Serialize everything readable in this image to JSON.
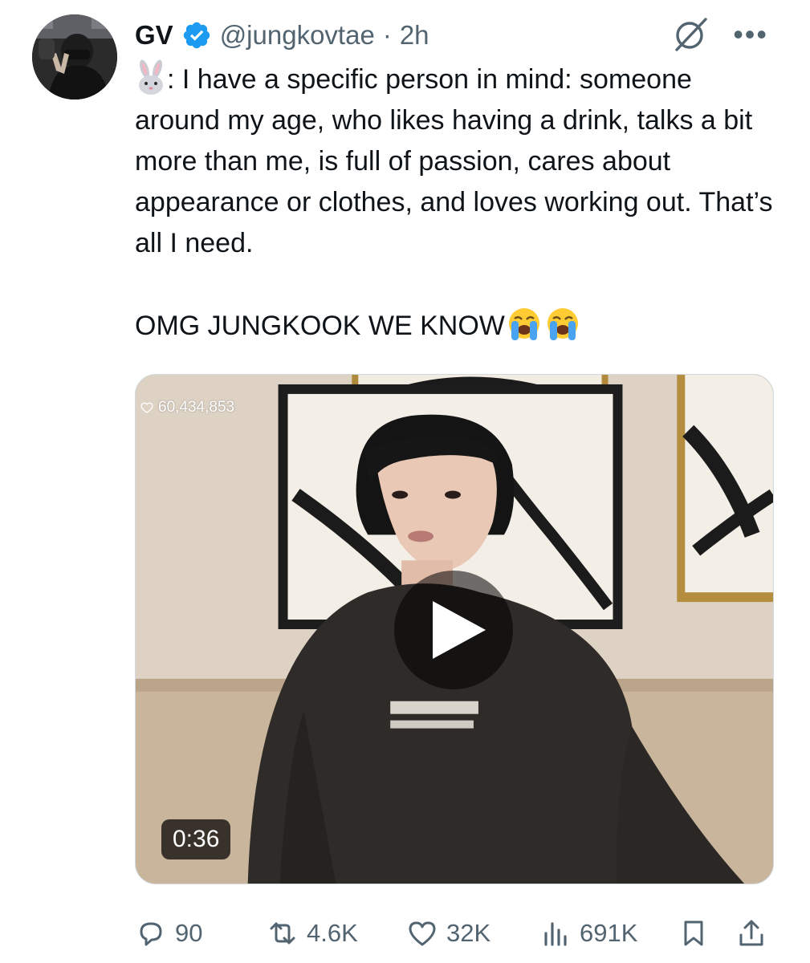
{
  "tweet": {
    "author_name": "GV",
    "handle": "@jungkovtae",
    "separator": "·",
    "time": "2h",
    "icons": {
      "verified": "verified-badge-icon",
      "grok": "grok-icon",
      "more": "more-options-icon"
    },
    "more_glyph": "•••",
    "text": {
      "line1_after_emoji": ": I have a specific person in mind: someone around my age, who likes having a drink, talks a bit more than me, is full of passion, cares about appearance or clothes, and loves working out. That’s all I need.",
      "line2": "OMG JUNGKOOK WE KNOW"
    },
    "media": {
      "type": "video",
      "views_overlay": "60,434,853",
      "duration": "0:36"
    },
    "actions": {
      "replies": "90",
      "reposts": "4.6K",
      "likes": "32K",
      "views": "691K"
    },
    "colors": {
      "verified": "#1d9bf0",
      "secondary_text": "#536471",
      "primary_text": "#0f1419"
    }
  }
}
